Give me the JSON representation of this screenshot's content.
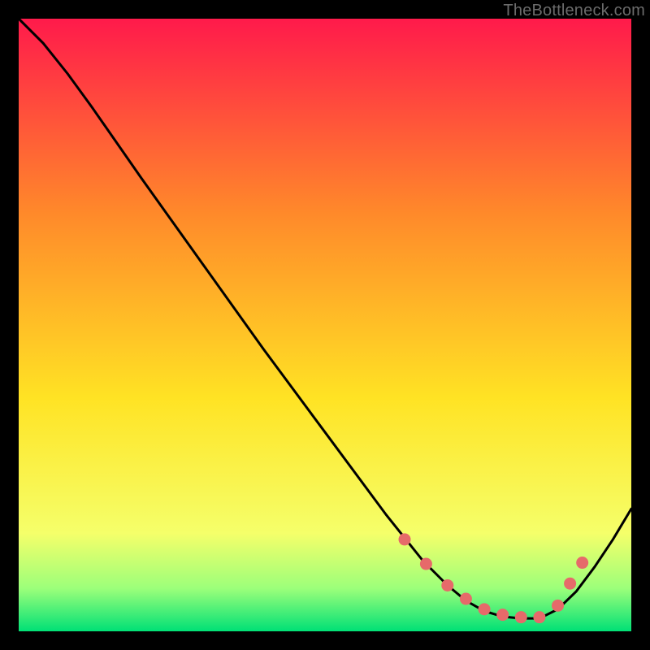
{
  "attribution": "TheBottleneck.com",
  "colors": {
    "gradient_top": "#ff1a4b",
    "gradient_upper_mid": "#ff8a2a",
    "gradient_mid": "#ffe324",
    "gradient_lower_mid": "#f5ff6a",
    "gradient_near_bottom": "#9cff7a",
    "gradient_bottom": "#00e076",
    "line": "#000000",
    "marker": "#e66a6a",
    "frame": "#000000"
  },
  "chart_data": {
    "type": "line",
    "title": "",
    "xlabel": "",
    "ylabel": "",
    "xlim": [
      0,
      100
    ],
    "ylim": [
      0,
      100
    ],
    "series": [
      {
        "name": "curve",
        "x": [
          0,
          4,
          8,
          12,
          20,
          30,
          40,
          50,
          60,
          66,
          70,
          73,
          76,
          79,
          82,
          85,
          88,
          91,
          94,
          97,
          100
        ],
        "y": [
          100,
          96,
          91,
          85.5,
          74,
          60,
          46,
          32.5,
          19,
          11.5,
          7.5,
          5,
          3.3,
          2.4,
          2.1,
          2.1,
          3.6,
          6.5,
          10.5,
          15,
          20
        ]
      }
    ],
    "markers": {
      "name": "highlight-points",
      "x": [
        63,
        66.5,
        70,
        73,
        76,
        79,
        82,
        85,
        88,
        90,
        92
      ],
      "y": [
        15,
        11,
        7.5,
        5.3,
        3.6,
        2.7,
        2.3,
        2.3,
        4.2,
        7.8,
        11.2
      ]
    }
  }
}
